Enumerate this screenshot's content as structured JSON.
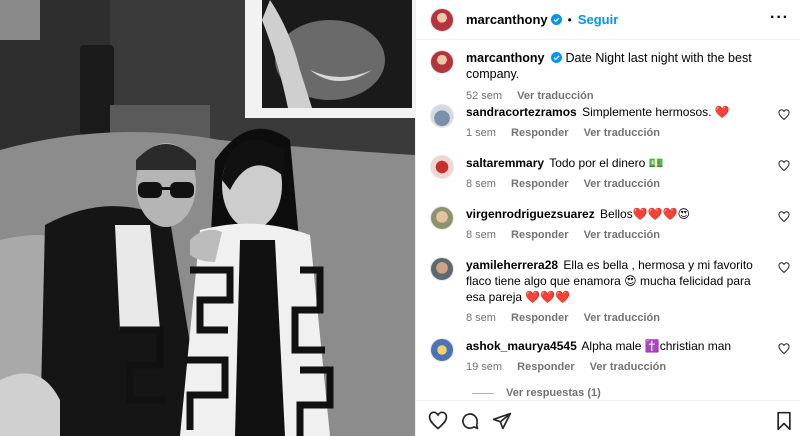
{
  "post": {
    "author": "marcanthony",
    "follow_label": "Seguir",
    "separator": "•",
    "caption": "Date Night last night with the best company.",
    "caption_age": "52 sem",
    "see_translation": "Ver traducción"
  },
  "comments": [
    {
      "user": "sandracortezramos",
      "text": "Simplemente hermosos. ❤️",
      "age": "1 sem",
      "reply": "Responder",
      "translate": "Ver traducción"
    },
    {
      "user": "saltaremmary",
      "text": "Todo por el dinero 💵",
      "age": "8 sem",
      "reply": "Responder",
      "translate": "Ver traducción"
    },
    {
      "user": "virgenrodriguezsuarez",
      "text": "Bellos❤️❤️❤️😍",
      "age": "8 sem",
      "reply": "Responder",
      "translate": "Ver traducción"
    },
    {
      "user": "yamileherrera28",
      "text": "Ella es bella , hermosa y mi favorito flaco tiene algo que enamora 😍 mucha felicidad para esa pareja ❤️❤️❤️",
      "age": "8 sem",
      "reply": "Responder",
      "translate": "Ver traducción"
    },
    {
      "user": "ashok_maurya4545",
      "text": "Alpha male ✝️christian man",
      "age": "19 sem",
      "reply": "Responder",
      "translate": "Ver traducción"
    }
  ],
  "view_replies": "Ver respuestas (1)",
  "colors": {
    "accent": "#0095f6",
    "muted": "#737373"
  },
  "icons": [
    "verified-badge-icon",
    "more-options-icon",
    "heart-icon",
    "comment-icon",
    "share-icon",
    "bookmark-icon"
  ]
}
